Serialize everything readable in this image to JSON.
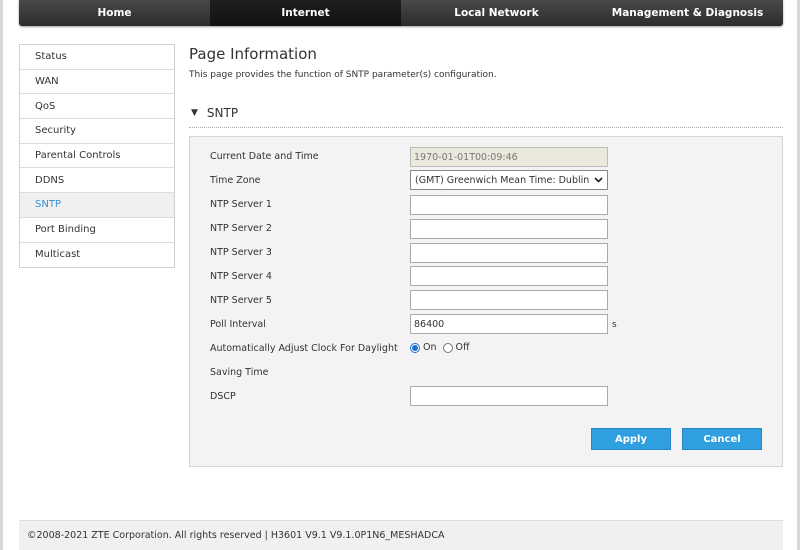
{
  "nav": {
    "tabs": [
      {
        "label": "Home"
      },
      {
        "label": "Internet"
      },
      {
        "label": "Local Network"
      },
      {
        "label": "Management & Diagnosis"
      }
    ],
    "active": "Internet"
  },
  "sidebar": {
    "items": [
      {
        "label": "Status"
      },
      {
        "label": "WAN"
      },
      {
        "label": "QoS"
      },
      {
        "label": "Security"
      },
      {
        "label": "Parental Controls"
      },
      {
        "label": "DDNS"
      },
      {
        "label": "SNTP"
      },
      {
        "label": "Port Binding"
      },
      {
        "label": "Multicast"
      }
    ],
    "active": "SNTP"
  },
  "page": {
    "title": "Page Information",
    "description": "This page provides the function of SNTP parameter(s) configuration."
  },
  "section": {
    "title": "SNTP"
  },
  "form": {
    "current_time_label": "Current Date and Time",
    "current_time_value": "1970-01-01T00:09:46",
    "timezone_label": "Time Zone",
    "timezone_value": "(GMT) Greenwich Mean Time: Dublin",
    "ntp1_label": "NTP Server 1",
    "ntp1_value": "",
    "ntp2_label": "NTP Server 2",
    "ntp2_value": "",
    "ntp3_label": "NTP Server 3",
    "ntp3_value": "",
    "ntp4_label": "NTP Server 4",
    "ntp4_value": "",
    "ntp5_label": "NTP Server 5",
    "ntp5_value": "",
    "poll_label": "Poll Interval",
    "poll_value": "86400",
    "poll_unit": "s",
    "dst_label_line1": "Automatically Adjust Clock For Daylight",
    "dst_label_line2": "Saving Time",
    "dst_on_label": "On",
    "dst_off_label": "Off",
    "dst_value": "On",
    "dscp_label": "DSCP",
    "dscp_value": ""
  },
  "buttons": {
    "apply": "Apply",
    "cancel": "Cancel"
  },
  "footer": {
    "copyright": "©2008-2021 ZTE Corporation. All rights reserved  |   H3601 V9.1 V9.1.0P1N6_MESHADCA"
  },
  "colors": {
    "accent": "#2f9fe0",
    "nav_bg": "#333333",
    "sidebar_active_text": "#3a8fd0"
  }
}
